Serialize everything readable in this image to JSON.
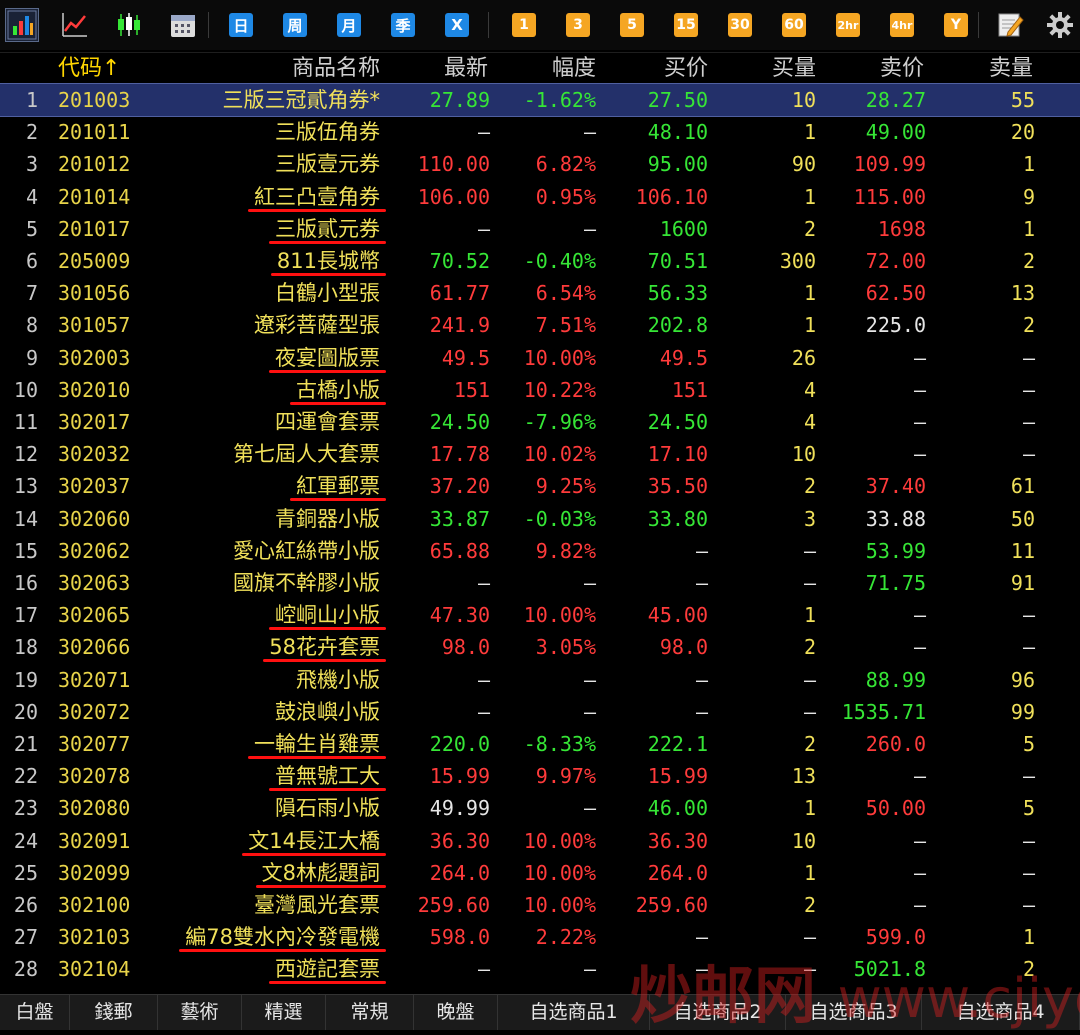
{
  "toolbar": {
    "buttons": [
      {
        "id": "bar-chart-icon",
        "kind": "icon"
      },
      {
        "id": "line-chart-icon",
        "kind": "icon"
      },
      {
        "id": "candlestick-icon",
        "kind": "icon"
      },
      {
        "id": "calendar-icon",
        "kind": "icon"
      },
      {
        "id": "day",
        "label": "日",
        "kind": "blue"
      },
      {
        "id": "week",
        "label": "周",
        "kind": "blue"
      },
      {
        "id": "month",
        "label": "月",
        "kind": "blue"
      },
      {
        "id": "season",
        "label": "季",
        "kind": "blue"
      },
      {
        "id": "x",
        "label": "X",
        "kind": "blue"
      },
      {
        "id": "min1",
        "label": "1",
        "kind": "orange"
      },
      {
        "id": "min3",
        "label": "3",
        "kind": "orange"
      },
      {
        "id": "min5",
        "label": "5",
        "kind": "orange"
      },
      {
        "id": "min15",
        "label": "15",
        "kind": "orange"
      },
      {
        "id": "min30",
        "label": "30",
        "kind": "orange"
      },
      {
        "id": "min60",
        "label": "60",
        "kind": "orange"
      },
      {
        "id": "hr2",
        "label": "2hr",
        "kind": "orange"
      },
      {
        "id": "hr4",
        "label": "4hr",
        "kind": "orange"
      },
      {
        "id": "year",
        "label": "Y",
        "kind": "orange"
      },
      {
        "id": "edit-icon",
        "kind": "icon"
      },
      {
        "id": "gear-icon",
        "kind": "icon"
      }
    ]
  },
  "header": {
    "code": "代码↑",
    "name": "商品名称",
    "last": "最新",
    "change": "幅度",
    "bid": "买价",
    "bid_vol": "买量",
    "ask": "卖价",
    "ask_vol": "卖量"
  },
  "colors": {
    "up": "#ff3b3b",
    "down": "#36e636",
    "flat": "#e6e6e6",
    "name": "#f0e05a",
    "underline": "#ff1010"
  },
  "rows": [
    {
      "i": "1",
      "code": "201003",
      "name": "三版三冠貳角券*",
      "last": "27.89",
      "lc": "green",
      "chg": "-1.62%",
      "cc": "green",
      "bid": "27.50",
      "bc": "green",
      "bv": "10",
      "ask": "28.27",
      "ac": "green",
      "av": "55",
      "selected": true
    },
    {
      "i": "2",
      "code": "201011",
      "name": "三版伍角券",
      "last": "—",
      "lc": "dash",
      "chg": "—",
      "cc": "dash",
      "bid": "48.10",
      "bc": "green",
      "bv": "1",
      "ask": "49.00",
      "ac": "green",
      "av": "20"
    },
    {
      "i": "3",
      "code": "201012",
      "name": "三版壹元券",
      "last": "110.00",
      "lc": "red",
      "chg": "6.82%",
      "cc": "red",
      "bid": "95.00",
      "bc": "green",
      "bv": "90",
      "ask": "109.99",
      "ac": "red",
      "av": "1"
    },
    {
      "i": "4",
      "code": "201014",
      "name": "紅三凸壹角券",
      "last": "106.00",
      "lc": "red",
      "chg": "0.95%",
      "cc": "red",
      "bid": "106.10",
      "bc": "red",
      "bv": "1",
      "ask": "115.00",
      "ac": "red",
      "av": "9",
      "ul": true
    },
    {
      "i": "5",
      "code": "201017",
      "name": "三版貳元券",
      "last": "—",
      "lc": "dash",
      "chg": "—",
      "cc": "dash",
      "bid": "1600",
      "bc": "green",
      "bv": "2",
      "ask": "1698",
      "ac": "red",
      "av": "1",
      "ul": true
    },
    {
      "i": "6",
      "code": "205009",
      "name": "811長城幣",
      "last": "70.52",
      "lc": "green",
      "chg": "-0.40%",
      "cc": "green",
      "bid": "70.51",
      "bc": "green",
      "bv": "300",
      "ask": "72.00",
      "ac": "red",
      "av": "2",
      "ul": true
    },
    {
      "i": "7",
      "code": "301056",
      "name": "白鶴小型張",
      "last": "61.77",
      "lc": "red",
      "chg": "6.54%",
      "cc": "red",
      "bid": "56.33",
      "bc": "green",
      "bv": "1",
      "ask": "62.50",
      "ac": "red",
      "av": "13"
    },
    {
      "i": "8",
      "code": "301057",
      "name": "遼彩菩薩型張",
      "last": "241.9",
      "lc": "red",
      "chg": "7.51%",
      "cc": "red",
      "bid": "202.8",
      "bc": "green",
      "bv": "1",
      "ask": "225.0",
      "ac": "white",
      "av": "2"
    },
    {
      "i": "9",
      "code": "302003",
      "name": "夜宴圖版票",
      "last": "49.5",
      "lc": "red",
      "chg": "10.00%",
      "cc": "red",
      "bid": "49.5",
      "bc": "red",
      "bv": "26",
      "ask": "—",
      "ac": "dash",
      "av": "—",
      "ul": true
    },
    {
      "i": "10",
      "code": "302010",
      "name": "古橋小版",
      "last": "151",
      "lc": "red",
      "chg": "10.22%",
      "cc": "red",
      "bid": "151",
      "bc": "red",
      "bv": "4",
      "ask": "—",
      "ac": "dash",
      "av": "—",
      "ul": true
    },
    {
      "i": "11",
      "code": "302017",
      "name": "四運會套票",
      "last": "24.50",
      "lc": "green",
      "chg": "-7.96%",
      "cc": "green",
      "bid": "24.50",
      "bc": "green",
      "bv": "4",
      "ask": "—",
      "ac": "dash",
      "av": "—"
    },
    {
      "i": "12",
      "code": "302032",
      "name": "第七屆人大套票",
      "last": "17.78",
      "lc": "red",
      "chg": "10.02%",
      "cc": "red",
      "bid": "17.10",
      "bc": "red",
      "bv": "10",
      "ask": "—",
      "ac": "dash",
      "av": "—"
    },
    {
      "i": "13",
      "code": "302037",
      "name": "紅軍郵票",
      "last": "37.20",
      "lc": "red",
      "chg": "9.25%",
      "cc": "red",
      "bid": "35.50",
      "bc": "red",
      "bv": "2",
      "ask": "37.40",
      "ac": "red",
      "av": "61",
      "ul": true
    },
    {
      "i": "14",
      "code": "302060",
      "name": "青銅器小版",
      "last": "33.87",
      "lc": "green",
      "chg": "-0.03%",
      "cc": "green",
      "bid": "33.80",
      "bc": "green",
      "bv": "3",
      "ask": "33.88",
      "ac": "white",
      "av": "50"
    },
    {
      "i": "15",
      "code": "302062",
      "name": "愛心紅絲帶小版",
      "last": "65.88",
      "lc": "red",
      "chg": "9.82%",
      "cc": "red",
      "bid": "—",
      "bc": "dash",
      "bv": "—",
      "ask": "53.99",
      "ac": "green",
      "av": "11"
    },
    {
      "i": "16",
      "code": "302063",
      "name": "國旗不幹膠小版",
      "last": "—",
      "lc": "dash",
      "chg": "—",
      "cc": "dash",
      "bid": "—",
      "bc": "dash",
      "bv": "—",
      "ask": "71.75",
      "ac": "green",
      "av": "91"
    },
    {
      "i": "17",
      "code": "302065",
      "name": "崆峒山小版",
      "last": "47.30",
      "lc": "red",
      "chg": "10.00%",
      "cc": "red",
      "bid": "45.00",
      "bc": "red",
      "bv": "1",
      "ask": "—",
      "ac": "dash",
      "av": "—",
      "ul": true
    },
    {
      "i": "18",
      "code": "302066",
      "name": "58花卉套票",
      "last": "98.0",
      "lc": "red",
      "chg": "3.05%",
      "cc": "red",
      "bid": "98.0",
      "bc": "red",
      "bv": "2",
      "ask": "—",
      "ac": "dash",
      "av": "—",
      "ul": true
    },
    {
      "i": "19",
      "code": "302071",
      "name": "飛機小版",
      "last": "—",
      "lc": "dash",
      "chg": "—",
      "cc": "dash",
      "bid": "—",
      "bc": "dash",
      "bv": "—",
      "ask": "88.99",
      "ac": "green",
      "av": "96"
    },
    {
      "i": "20",
      "code": "302072",
      "name": "鼓浪嶼小版",
      "last": "—",
      "lc": "dash",
      "chg": "—",
      "cc": "dash",
      "bid": "—",
      "bc": "dash",
      "bv": "—",
      "ask": "1535.71",
      "ac": "green",
      "av": "99"
    },
    {
      "i": "21",
      "code": "302077",
      "name": "一輪生肖雞票",
      "last": "220.0",
      "lc": "green",
      "chg": "-8.33%",
      "cc": "green",
      "bid": "222.1",
      "bc": "green",
      "bv": "2",
      "ask": "260.0",
      "ac": "red",
      "av": "5",
      "ul": true
    },
    {
      "i": "22",
      "code": "302078",
      "name": "普無號工大",
      "last": "15.99",
      "lc": "red",
      "chg": "9.97%",
      "cc": "red",
      "bid": "15.99",
      "bc": "red",
      "bv": "13",
      "ask": "—",
      "ac": "dash",
      "av": "—",
      "ul": true
    },
    {
      "i": "23",
      "code": "302080",
      "name": "隕石雨小版",
      "last": "49.99",
      "lc": "white",
      "chg": "—",
      "cc": "dash",
      "bid": "46.00",
      "bc": "green",
      "bv": "1",
      "ask": "50.00",
      "ac": "red",
      "av": "5"
    },
    {
      "i": "24",
      "code": "302091",
      "name": "文14長江大橋",
      "last": "36.30",
      "lc": "red",
      "chg": "10.00%",
      "cc": "red",
      "bid": "36.30",
      "bc": "red",
      "bv": "10",
      "ask": "—",
      "ac": "dash",
      "av": "—",
      "ul": true
    },
    {
      "i": "25",
      "code": "302099",
      "name": "文8林彪題詞",
      "last": "264.0",
      "lc": "red",
      "chg": "10.00%",
      "cc": "red",
      "bid": "264.0",
      "bc": "red",
      "bv": "1",
      "ask": "—",
      "ac": "dash",
      "av": "—",
      "ul": true
    },
    {
      "i": "26",
      "code": "302100",
      "name": "臺灣風光套票",
      "last": "259.60",
      "lc": "red",
      "chg": "10.00%",
      "cc": "red",
      "bid": "259.60",
      "bc": "red",
      "bv": "2",
      "ask": "—",
      "ac": "dash",
      "av": "—"
    },
    {
      "i": "27",
      "code": "302103",
      "name": "編78雙水內冷發電機",
      "last": "598.0",
      "lc": "red",
      "chg": "2.22%",
      "cc": "red",
      "bid": "—",
      "bc": "dash",
      "bv": "—",
      "ask": "599.0",
      "ac": "red",
      "av": "1",
      "ul": true
    },
    {
      "i": "28",
      "code": "302104",
      "name": "西遊記套票",
      "last": "—",
      "lc": "dash",
      "chg": "—",
      "cc": "dash",
      "bid": "—",
      "bc": "dash",
      "bv": "—",
      "ask": "5021.8",
      "ac": "green",
      "av": "2",
      "ul": true
    }
  ],
  "tabs": [
    "白盤",
    "錢郵",
    "藝術",
    "精選",
    "常規",
    "晚盤",
    "自选商品1",
    "自选商品2",
    "自选商品3",
    "自选商品4"
  ],
  "watermark": {
    "brand": "炒邮网",
    "url": "www.cjiyou.net"
  }
}
